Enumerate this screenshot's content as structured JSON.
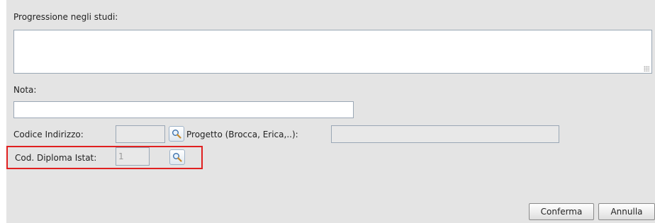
{
  "form": {
    "progressione_label": "Progressione negli studi:",
    "progressione_value": "",
    "nota_label": "Nota:",
    "nota_value": "",
    "codice_indirizzo_label": "Codice Indirizzo:",
    "codice_indirizzo_value": "",
    "progetto_label": "Progetto (Brocca, Erica,..):",
    "progetto_value": "",
    "cod_diploma_label": "Cod. Diploma Istat:",
    "cod_diploma_value": "1"
  },
  "buttons": {
    "confirm_label": "Conferma",
    "cancel_label": "Annulla"
  },
  "icons": {
    "search": "magnifier-icon"
  },
  "colors": {
    "panel_bg": "#e4e4e4",
    "highlight": "#e02020"
  }
}
